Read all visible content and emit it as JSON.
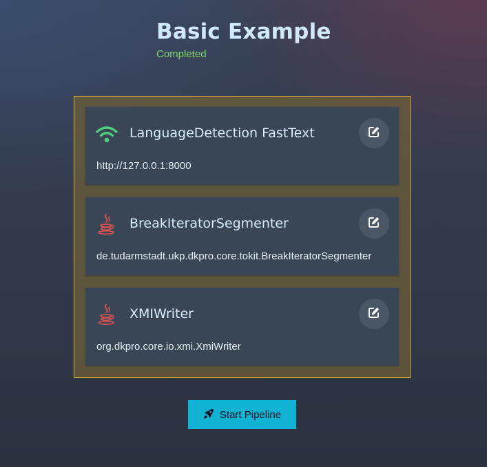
{
  "header": {
    "title": "Basic Example",
    "status": "Completed"
  },
  "colors": {
    "frame_border": "#e0b43a",
    "card_bg": "#3a4656",
    "status_green": "#7fd86a",
    "wifi_green": "#4cd07d",
    "java_red": "#d9534f",
    "button_cyan": "#12b2d3"
  },
  "components": [
    {
      "name": "LanguageDetection FastText",
      "detail": "http://127.0.0.1:8000",
      "icon": "wifi-icon"
    },
    {
      "name": "BreakIteratorSegmenter",
      "detail": "de.tudarmstadt.ukp.dkpro.core.tokit.BreakIteratorSegmenter",
      "icon": "java-icon"
    },
    {
      "name": "XMIWriter",
      "detail": "org.dkpro.core.io.xmi.XmiWriter",
      "icon": "java-icon"
    }
  ],
  "actions": {
    "start_label": "Start Pipeline",
    "start_icon": "rocket-icon",
    "edit_icon": "edit-icon"
  }
}
